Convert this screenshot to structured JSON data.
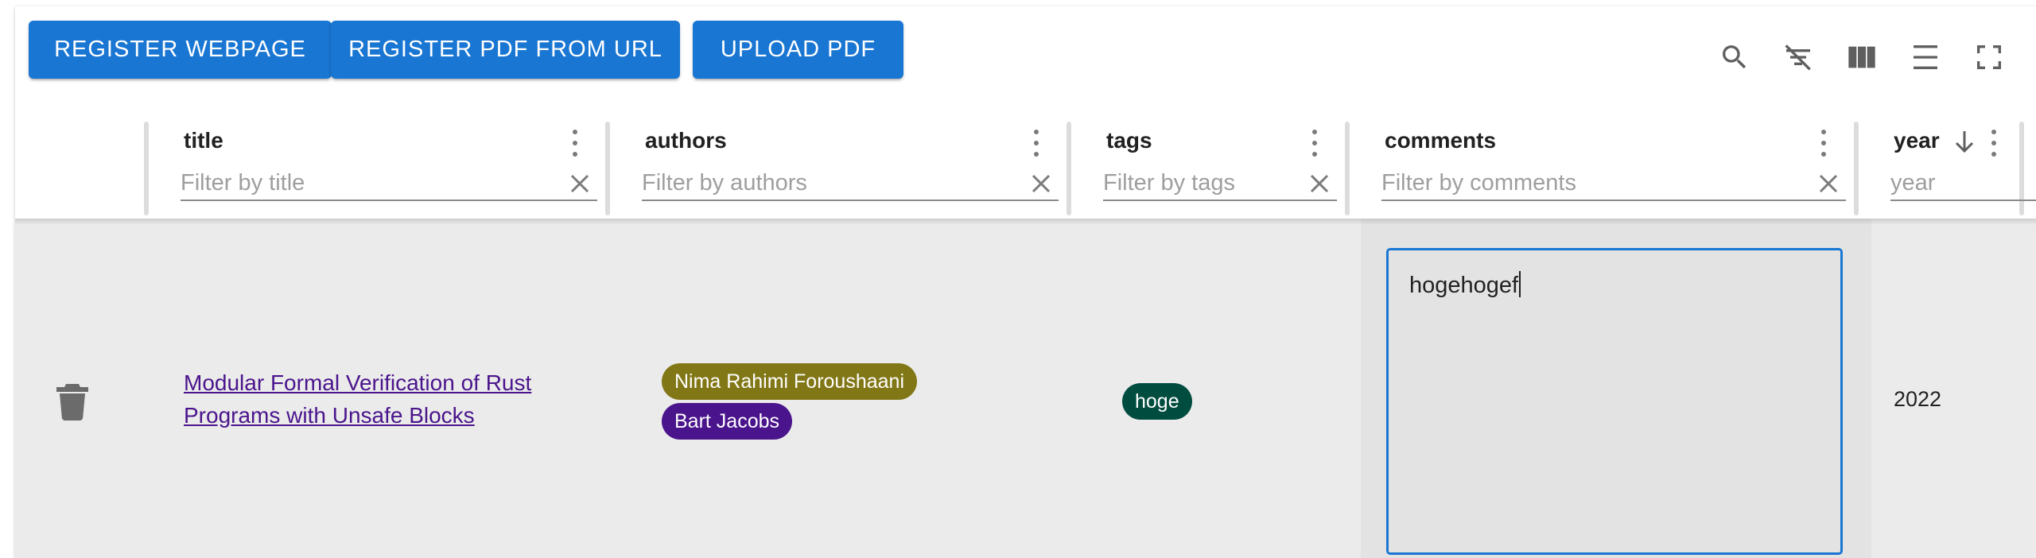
{
  "toolbar": {
    "register_webpage": "Register webpage",
    "register_pdf_from_url": "Register PDF from URL",
    "upload_pdf": "Upload PDF",
    "icons": [
      "search-icon",
      "filter-off-icon",
      "columns-icon",
      "density-icon",
      "fullscreen-icon"
    ]
  },
  "columns": {
    "title": {
      "label": "title",
      "placeholder": "Filter by title"
    },
    "authors": {
      "label": "authors",
      "placeholder": "Filter by authors"
    },
    "tags": {
      "label": "tags",
      "placeholder": "Filter by tags"
    },
    "comments": {
      "label": "comments",
      "placeholder": "Filter by comments"
    },
    "year": {
      "label": "year",
      "placeholder": "year",
      "sort": "descending"
    }
  },
  "rows": [
    {
      "title": "Modular Formal Verification of Rust Programs with Unsafe Blocks",
      "authors": [
        {
          "name": "Nima Rahimi Foroushaani",
          "color": "#827717"
        },
        {
          "name": "Bart Jacobs",
          "color": "#4a148c"
        }
      ],
      "tags": [
        {
          "name": "hoge",
          "color": "#004d40"
        }
      ],
      "comments": "hogehogef",
      "year": "2022"
    }
  ],
  "colors": {
    "primary": "#1976d2",
    "link": "#4a148c",
    "row_background": "#ebebeb"
  }
}
